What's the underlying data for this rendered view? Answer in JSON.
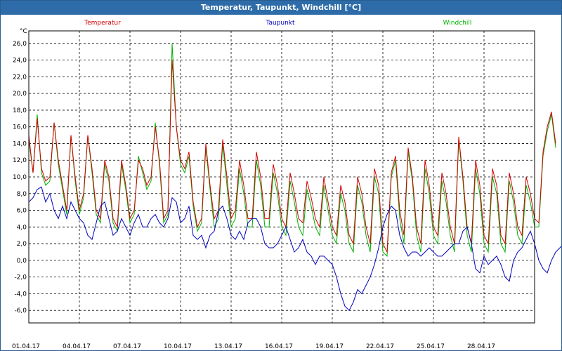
{
  "window": {
    "title": "Temperatur, Taupunkt, Windchill [°C]"
  },
  "chart_data": {
    "type": "line",
    "title": "Temperatur, Taupunkt, Windchill [°C]",
    "ylabel": "°C",
    "xlabel": "",
    "x_start": "01.04.17",
    "x_end": "30.04.17",
    "x_step_days": 0.25,
    "ylim": [
      -7.5,
      27.5
    ],
    "yticks": [
      -6,
      -4,
      -2,
      0,
      2,
      4,
      6,
      8,
      10,
      12,
      14,
      16,
      18,
      20,
      22,
      24,
      26
    ],
    "ytick_labels": [
      "-6,0",
      "-4,0",
      "-2,0",
      "0,0",
      "2,0",
      "4,0",
      "6,0",
      "8,0",
      "10,0",
      "12,0",
      "14,0",
      "16,0",
      "18,0",
      "20,0",
      "22,0",
      "24,0",
      "26,0"
    ],
    "xtick_labels": [
      "01.04.17",
      "04.04.17",
      "07.04.17",
      "10.04.17",
      "13.04.17",
      "16.04.17",
      "19.04.17",
      "22.04.17",
      "25.04.17",
      "28.04.17"
    ],
    "grid": true,
    "legend_placement": "top",
    "series": [
      {
        "name": "Temperatur",
        "color": "#d40000",
        "values": [
          15.0,
          10.5,
          17.0,
          11.0,
          9.5,
          10.0,
          16.5,
          12.0,
          9.0,
          6.0,
          15.0,
          10.0,
          6.0,
          8.0,
          15.0,
          11.0,
          6.0,
          5.0,
          12.0,
          10.0,
          5.0,
          4.0,
          12.0,
          9.0,
          5.0,
          6.0,
          12.0,
          11.0,
          9.0,
          10.0,
          16.0,
          12.0,
          5.0,
          6.0,
          24.0,
          16.0,
          12.0,
          11.0,
          13.0,
          7.0,
          4.0,
          5.0,
          14.0,
          9.0,
          5.0,
          6.0,
          14.5,
          10.0,
          5.0,
          6.0,
          12.0,
          9.0,
          5.0,
          5.0,
          13.0,
          10.0,
          5.0,
          5.0,
          11.5,
          9.0,
          5.0,
          4.0,
          10.5,
          8.0,
          5.0,
          4.5,
          9.5,
          7.5,
          5.0,
          4.0,
          10.0,
          7.0,
          4.0,
          3.0,
          9.0,
          7.0,
          3.0,
          2.0,
          10.0,
          8.0,
          4.0,
          2.0,
          11.0,
          9.0,
          2.0,
          1.0,
          10.5,
          12.5,
          6.0,
          3.0,
          13.5,
          10.0,
          4.0,
          2.0,
          12.0,
          9.0,
          4.0,
          3.0,
          10.5,
          8.0,
          4.0,
          2.0,
          14.8,
          10.0,
          4.0,
          2.0,
          12.0,
          9.0,
          3.0,
          2.0,
          11.0,
          9.0,
          3.0,
          2.0,
          10.5,
          8.0,
          4.0,
          3.0,
          10.0,
          8.0,
          5.0,
          4.5,
          13.0,
          16.0,
          17.8,
          14.0
        ]
      },
      {
        "name": "Taupunkt",
        "color": "#0000c0",
        "values": [
          7.0,
          7.5,
          8.5,
          8.8,
          7.0,
          8.0,
          6.0,
          5.0,
          6.5,
          5.0,
          7.0,
          6.0,
          5.0,
          4.5,
          3.0,
          2.5,
          4.5,
          6.5,
          7.0,
          5.0,
          3.0,
          3.5,
          5.0,
          4.0,
          3.0,
          4.5,
          5.5,
          4.0,
          4.0,
          5.0,
          5.5,
          4.5,
          4.0,
          5.0,
          7.5,
          7.0,
          4.5,
          5.0,
          6.5,
          3.0,
          2.5,
          3.0,
          1.5,
          3.0,
          3.5,
          6.0,
          6.5,
          5.0,
          3.0,
          2.5,
          3.5,
          2.5,
          4.5,
          5.0,
          5.0,
          4.0,
          2.0,
          1.5,
          1.5,
          2.0,
          3.0,
          4.0,
          2.5,
          1.0,
          1.5,
          2.5,
          1.0,
          0.5,
          -0.5,
          0.5,
          0.5,
          0.0,
          -0.5,
          -2.0,
          -4.0,
          -5.5,
          -6.0,
          -5.0,
          -3.5,
          -4.0,
          -3.0,
          -2.0,
          -0.5,
          1.5,
          4.0,
          5.5,
          6.5,
          6.0,
          3.0,
          1.5,
          0.5,
          1.0,
          1.0,
          0.5,
          1.0,
          1.5,
          1.0,
          0.5,
          0.5,
          1.0,
          1.5,
          2.0,
          2.0,
          3.5,
          4.0,
          2.0,
          -1.0,
          -1.5,
          0.5,
          -0.5,
          0.0,
          0.5,
          -0.5,
          -2.0,
          -2.5,
          0.0,
          1.0,
          1.5,
          2.5,
          3.5,
          2.0,
          0.0,
          -1.0,
          -1.5,
          0.0,
          1.0,
          1.5,
          2.0
        ]
      },
      {
        "name": "Windchill",
        "color": "#00b000",
        "values": [
          14.5,
          10.5,
          17.5,
          10.5,
          9.0,
          9.5,
          16.5,
          11.5,
          8.5,
          5.5,
          15.0,
          9.5,
          5.5,
          7.5,
          15.0,
          10.5,
          5.5,
          4.5,
          11.5,
          9.5,
          4.5,
          3.5,
          11.5,
          8.5,
          4.5,
          5.5,
          12.5,
          10.5,
          8.5,
          9.5,
          16.5,
          11.5,
          4.5,
          5.5,
          26.0,
          16.0,
          11.5,
          10.5,
          12.5,
          6.5,
          3.5,
          4.5,
          13.5,
          8.5,
          4.0,
          5.0,
          14.0,
          9.0,
          4.0,
          5.0,
          11.0,
          8.0,
          4.0,
          4.0,
          12.0,
          9.0,
          4.0,
          4.0,
          10.5,
          8.0,
          4.0,
          3.0,
          9.5,
          7.0,
          4.0,
          3.0,
          8.5,
          6.5,
          4.0,
          3.0,
          9.0,
          6.0,
          3.0,
          2.0,
          8.0,
          6.0,
          2.0,
          1.0,
          9.0,
          7.0,
          3.0,
          1.0,
          10.0,
          8.0,
          1.0,
          0.5,
          10.0,
          12.0,
          5.0,
          2.0,
          13.0,
          9.5,
          3.0,
          1.0,
          11.0,
          8.0,
          3.0,
          2.0,
          9.5,
          7.0,
          3.0,
          1.0,
          14.5,
          9.5,
          3.0,
          1.0,
          11.0,
          8.0,
          2.0,
          1.0,
          10.0,
          8.0,
          2.0,
          1.0,
          9.5,
          7.0,
          3.0,
          2.0,
          9.0,
          7.0,
          4.0,
          4.0,
          12.5,
          15.5,
          17.5,
          13.5
        ]
      }
    ]
  }
}
